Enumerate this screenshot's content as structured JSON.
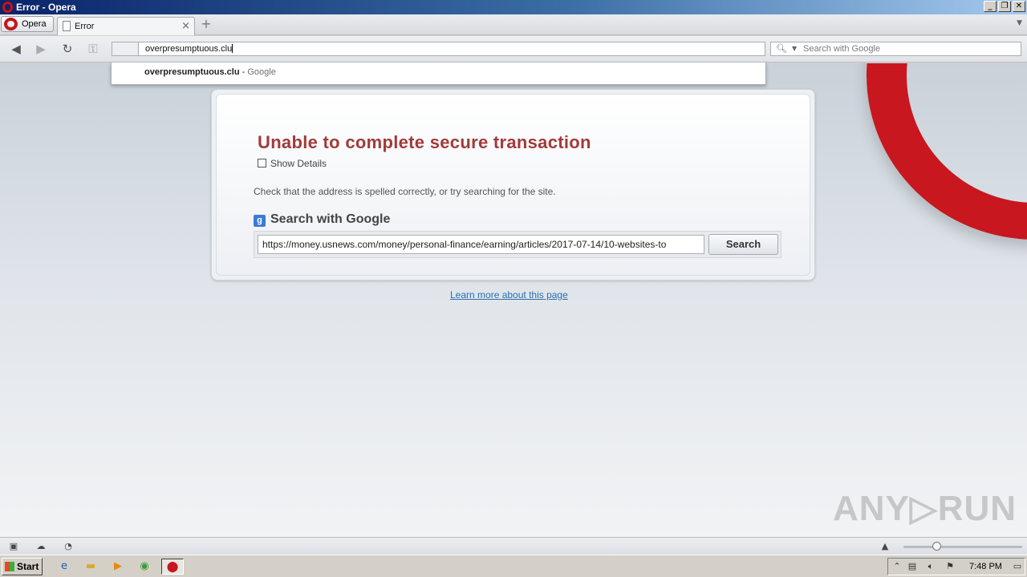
{
  "window": {
    "title": "Error - Opera",
    "controls": {
      "minimize": "_",
      "restore": "❐",
      "close": "✕"
    }
  },
  "tabs": {
    "menu_label": "Opera",
    "items": [
      {
        "label": "Error",
        "close": "×"
      }
    ],
    "new_tab": "+"
  },
  "toolbar": {
    "address_value": "overpresumptuous.clu",
    "search_placeholder": "Search with Google"
  },
  "suggestion": {
    "bold": "overpresumptuous.clu",
    "sep": " - ",
    "source": "Google"
  },
  "error_page": {
    "title": "Unable to complete secure transaction",
    "show_details": "Show Details",
    "hint": "Check that the address is spelled correctly, or try searching for the site.",
    "search_heading": "Search with Google",
    "search_value": "https://money.usnews.com/money/personal-finance/earning/articles/2017-07-14/10-websites-to",
    "search_button": "Search",
    "learn_more": "Learn more about this page"
  },
  "watermark": "ANY▷RUN",
  "statusbar": {
    "zoom_level": 0.28
  },
  "taskbar": {
    "start_label": "Start",
    "clock": "7:48 PM"
  },
  "colors": {
    "opera_red": "#c8171e",
    "error_title": "#a33a3a",
    "link": "#2a6fb0"
  }
}
